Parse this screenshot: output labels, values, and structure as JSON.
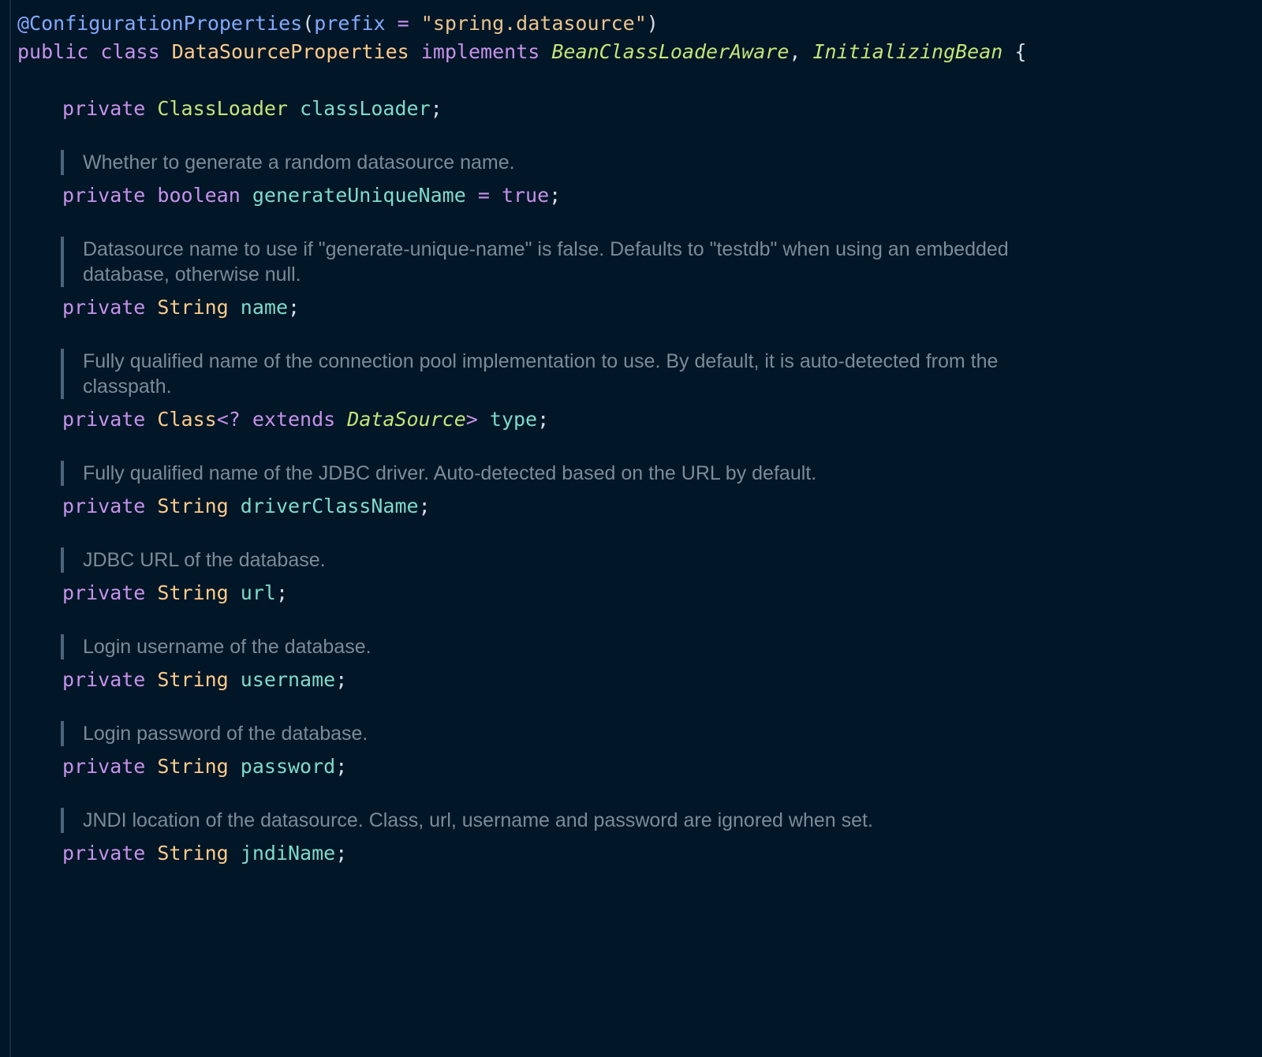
{
  "annotation": {
    "name": "@ConfigurationProperties",
    "param": "prefix",
    "value": "\"spring.datasource\""
  },
  "class_decl": {
    "modifiers": "public class",
    "name": "DataSourceProperties",
    "implements": "implements",
    "interfaces": [
      "BeanClassLoaderAware",
      "InitializingBean"
    ]
  },
  "fields": [
    {
      "doc": "",
      "modifier": "private",
      "type": "ClassLoader",
      "name": "classLoader",
      "init": ""
    },
    {
      "doc": "Whether to generate a random datasource name.",
      "modifier": "private",
      "type": "boolean",
      "name": "generateUniqueName",
      "init": "true"
    },
    {
      "doc": "Datasource name to use if \"generate-unique-name\" is false. Defaults to \"testdb\" when using an embedded database, otherwise null.",
      "modifier": "private",
      "type": "String",
      "name": "name",
      "init": ""
    },
    {
      "doc": "Fully qualified name of the connection pool implementation to use. By default, it is auto-detected from the classpath.",
      "modifier": "private",
      "type": "Class",
      "generic_extends": "extends",
      "generic_bound": "DataSource",
      "name": "type",
      "init": ""
    },
    {
      "doc": "Fully qualified name of the JDBC driver. Auto-detected based on the URL by default.",
      "modifier": "private",
      "type": "String",
      "name": "driverClassName",
      "init": ""
    },
    {
      "doc": "JDBC URL of the database.",
      "modifier": "private",
      "type": "String",
      "name": "url",
      "init": ""
    },
    {
      "doc": "Login username of the database.",
      "modifier": "private",
      "type": "String",
      "name": "username",
      "init": ""
    },
    {
      "doc": "Login password of the database.",
      "modifier": "private",
      "type": "String",
      "name": "password",
      "init": ""
    },
    {
      "doc": "JNDI location of the datasource. Class, url, username and password are ignored when set.",
      "modifier": "private",
      "type": "String",
      "name": "jndiName",
      "init": ""
    }
  ],
  "colors": {
    "background": "#011627",
    "keyword": "#c792ea",
    "class_type": "#ffcb8b",
    "interface": "#c5e478",
    "variable": "#7fdbca",
    "annotation": "#82aaff",
    "string": "#ecc48d",
    "doc_text": "#7c8b97"
  }
}
